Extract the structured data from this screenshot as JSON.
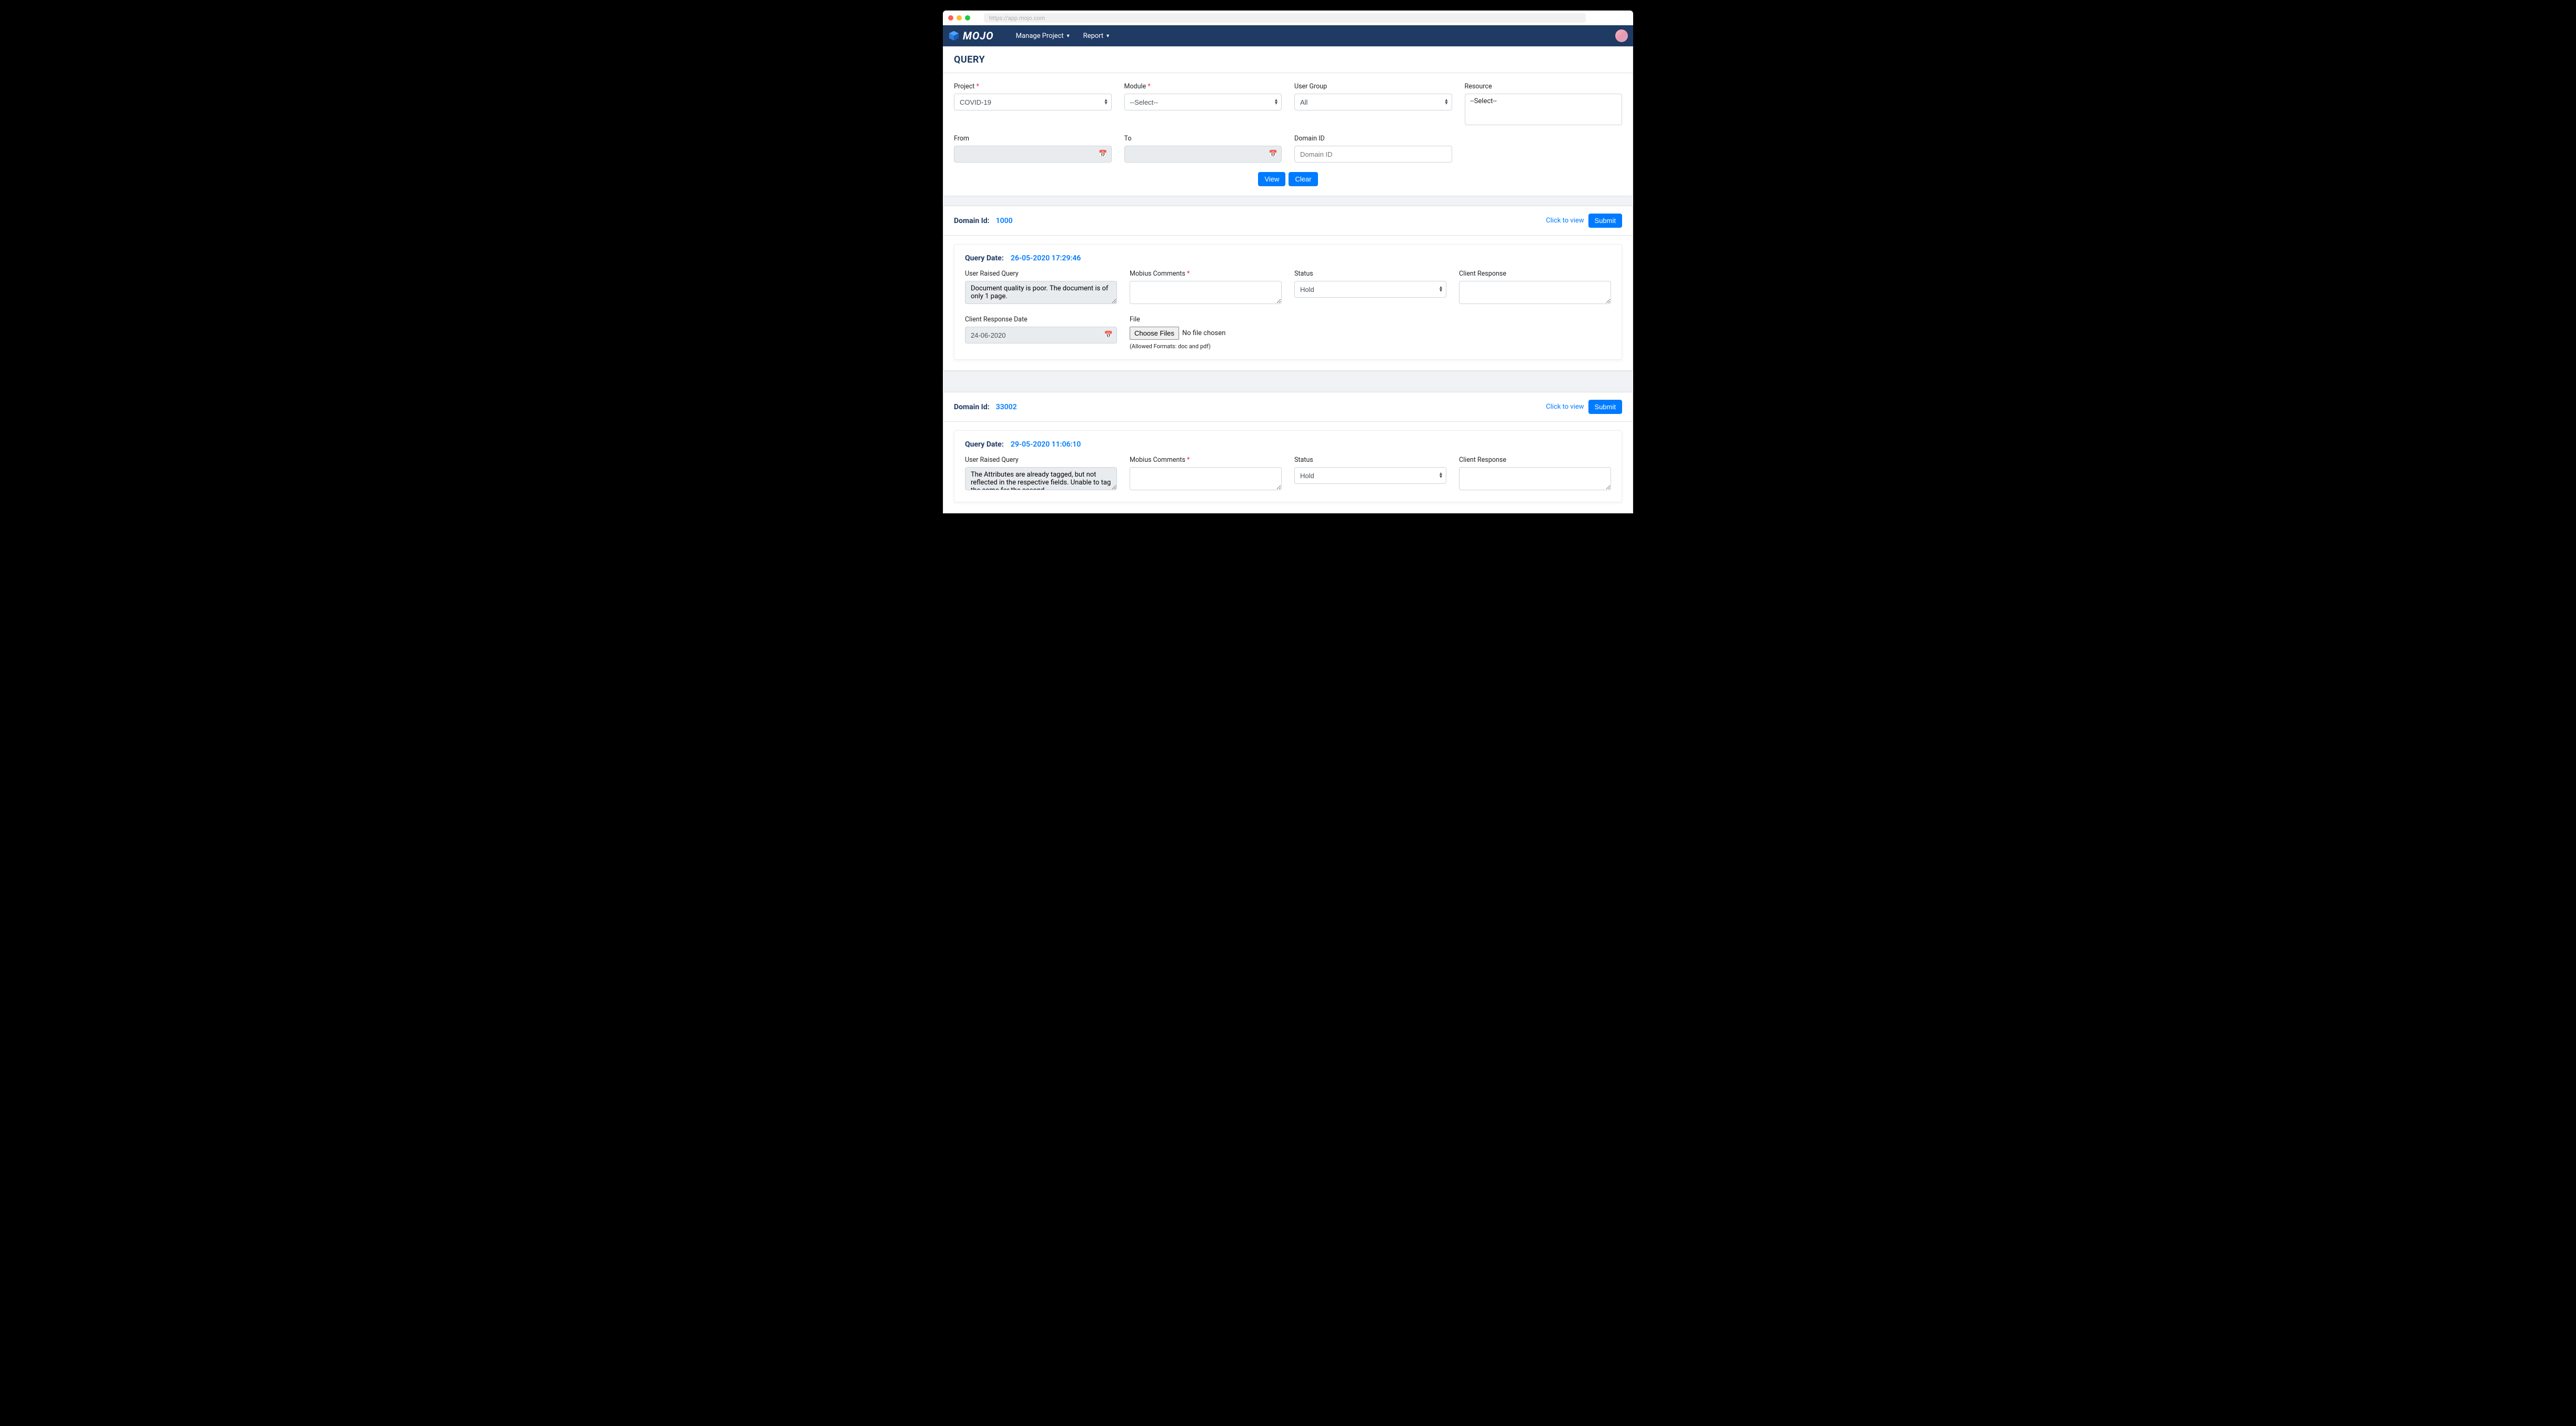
{
  "browser": {
    "url": "https://app.mojo.com"
  },
  "nav": {
    "brand": "MOJO",
    "manage_project": "Manage Project",
    "report": "Report"
  },
  "page": {
    "title": "QUERY"
  },
  "filters": {
    "project": {
      "label": "Project",
      "value": "COVID-19"
    },
    "module": {
      "label": "Module",
      "value": "--Select--"
    },
    "user_group": {
      "label": "User Group",
      "value": "All"
    },
    "resource": {
      "label": "Resource",
      "value": "--Select--"
    },
    "from": {
      "label": "From",
      "value": ""
    },
    "to": {
      "label": "To",
      "value": ""
    },
    "domain_id": {
      "label": "Domain ID",
      "placeholder": "Domain ID"
    },
    "view_btn": "View",
    "clear_btn": "Clear"
  },
  "common": {
    "domain_id_label": "Domain Id:",
    "click_to_view": "Click to view",
    "submit": "Submit",
    "query_date_label": "Query Date:",
    "user_raised_query": "User Raised Query",
    "mobius_comments": "Mobius Comments",
    "status": "Status",
    "client_response": "Client Response",
    "client_response_date": "Client Response Date",
    "file": "File",
    "choose_files": "Choose Files",
    "no_file_chosen": "No file chosen",
    "file_hint": "(Allowed Formats: doc and pdf)"
  },
  "records": [
    {
      "domain_id": "1000",
      "query_date": "26-05-2020 17:29:46",
      "user_query": "Document quality is poor. The document is of only 1 page.",
      "mobius_comments": "",
      "status": "Hold",
      "client_response": "",
      "client_response_date": "24-06-2020"
    },
    {
      "domain_id": "33002",
      "query_date": "29-05-2020 11:06:10",
      "user_query": "The Attributes are already tagged, but not reflected in the respective fields. Unable to tag the same for the second",
      "mobius_comments": "",
      "status": "Hold",
      "client_response": "",
      "client_response_date": ""
    }
  ]
}
